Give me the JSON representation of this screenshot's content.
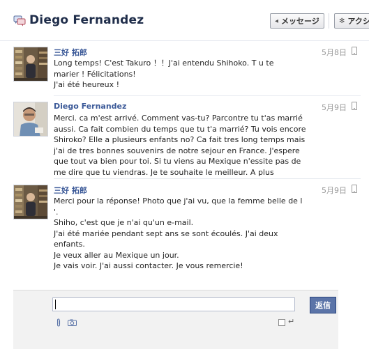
{
  "header": {
    "title": "Diego Fernandez",
    "message_button": "メッセージ",
    "action_button": "アクシ"
  },
  "messages": [
    {
      "sender": "三好 拓郎",
      "date": "5月8日",
      "lines": [
        "Long temps! C'est Takuro ！！J'ai entendu Shihoko. T u te",
        "marier ! Félicitations!",
        "J'ai été heureux !"
      ]
    },
    {
      "sender": "Diego Fernandez",
      "date": "5月9日",
      "lines": [
        "Merci. ca m'est arrivé. Comment vas-tu? Parcontre tu t'as marrié",
        "aussi. Ca fait combien du temps que tu t'a marrié? Tu vois encore",
        "Shiroko? Elle a plusieurs enfants no? Ca fait tres long temps mais",
        "j'ai de tres bonnes souvenirs de notre sejour en France. J'espere",
        "que tout va bien pour toi. Si tu viens au Mexique n'essite pas de",
        "me dire que tu viendras. Je te souhaite le meilleur. A plus"
      ]
    },
    {
      "sender": "三好 拓郎",
      "date": "5月9日",
      "lines": [
        "Merci pour la réponse! Photo que j'ai vu, que la femme belle de l",
        "'.",
        "Shiho, c'est que je n'ai qu'un e-mail.",
        "J'ai été mariée pendant sept ans se sont écoulés. J'ai deux",
        "enfants.",
        "Je veux aller au Mexique un jour.",
        "Je vais voir. J'ai aussi contacter. Je vous remercie!"
      ]
    }
  ],
  "composer": {
    "input_value": "",
    "send_label": "返信"
  },
  "colors": {
    "link": "#3b5998",
    "send_button": "#5b74a8"
  },
  "icons": {
    "header": "chat-bubbles-icon",
    "message_button": "reply-arrow-icon",
    "action_button": "gear-icon",
    "attach": "paperclip-icon",
    "camera": "camera-icon",
    "enter": "enter-key-icon",
    "phone": "mobile-phone-icon"
  }
}
